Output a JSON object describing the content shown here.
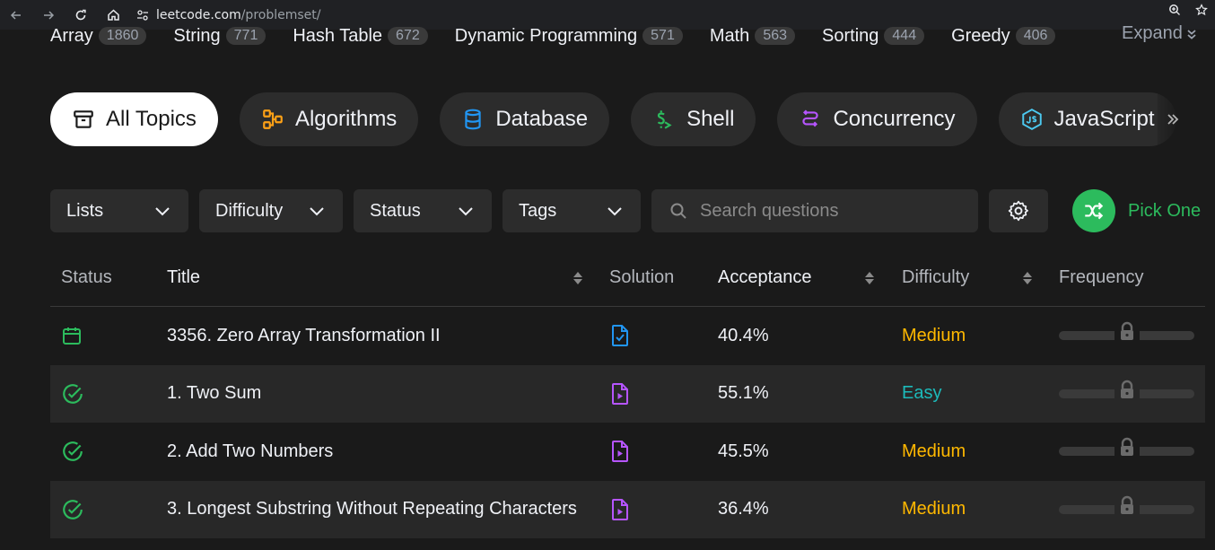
{
  "browser": {
    "url_host": "leetcode.com",
    "url_path": "/problemset/"
  },
  "tags": [
    {
      "name": "Array",
      "count": "1860"
    },
    {
      "name": "String",
      "count": "771"
    },
    {
      "name": "Hash Table",
      "count": "672"
    },
    {
      "name": "Dynamic Programming",
      "count": "571"
    },
    {
      "name": "Math",
      "count": "563"
    },
    {
      "name": "Sorting",
      "count": "444"
    },
    {
      "name": "Greedy",
      "count": "406"
    }
  ],
  "tags_expand": "Expand",
  "topics": [
    {
      "label": "All Topics",
      "icon": "archive-icon",
      "color": "#1a1a1a"
    },
    {
      "label": "Algorithms",
      "icon": "flow-icon",
      "color": "#ffa116"
    },
    {
      "label": "Database",
      "icon": "database-icon",
      "color": "#2196f3"
    },
    {
      "label": "Shell",
      "icon": "terminal-icon",
      "color": "#2cbb5d"
    },
    {
      "label": "Concurrency",
      "icon": "concurrency-icon",
      "color": "#b655ff"
    },
    {
      "label": "JavaScript",
      "icon": "js-icon",
      "color": "#4cc9f0"
    }
  ],
  "filters": {
    "lists": "Lists",
    "difficulty": "Difficulty",
    "status": "Status",
    "tags": "Tags",
    "search_placeholder": "Search questions",
    "pick_one": "Pick One"
  },
  "table": {
    "headers": {
      "status": "Status",
      "title": "Title",
      "solution": "Solution",
      "acceptance": "Acceptance",
      "difficulty": "Difficulty",
      "frequency": "Frequency"
    },
    "rows": [
      {
        "status_icon": "calendar-icon",
        "title": "3356. Zero Array Transformation II",
        "solution_icon": "doc-check-icon",
        "acceptance": "40.4%",
        "difficulty": "Medium"
      },
      {
        "status_icon": "check-circle-icon",
        "title": "1. Two Sum",
        "solution_icon": "video-doc-icon",
        "acceptance": "55.1%",
        "difficulty": "Easy"
      },
      {
        "status_icon": "check-circle-icon",
        "title": "2. Add Two Numbers",
        "solution_icon": "video-doc-icon",
        "acceptance": "45.5%",
        "difficulty": "Medium"
      },
      {
        "status_icon": "check-circle-icon",
        "title": "3. Longest Substring Without Repeating Characters",
        "solution_icon": "video-doc-icon",
        "acceptance": "36.4%",
        "difficulty": "Medium"
      }
    ]
  },
  "colors": {
    "green": "#2cbb5d",
    "easy": "#1cbaba",
    "medium": "#ffb800",
    "solution_blue": "#2196f3",
    "solution_purple": "#b655ff"
  }
}
